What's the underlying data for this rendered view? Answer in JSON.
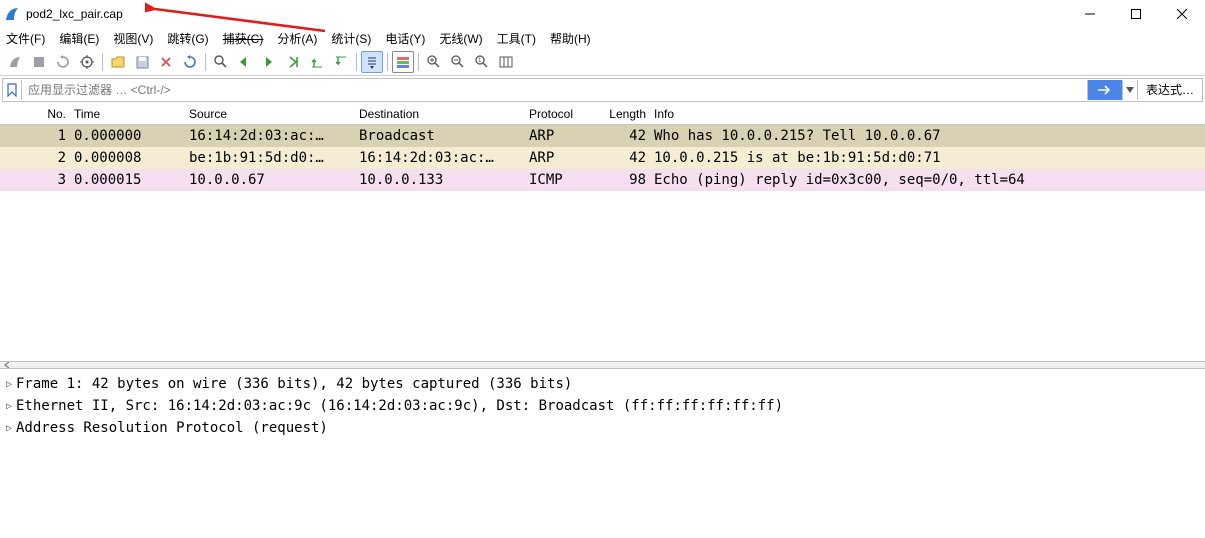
{
  "title": "pod2_lxc_pair.cap",
  "menu": {
    "file": "文件(F)",
    "edit": "编辑(E)",
    "view": "视图(V)",
    "go": "跳转(G)",
    "capture": "捕获(C)",
    "analyze": "分析(A)",
    "stat": "统计(S)",
    "tel": "电话(Y)",
    "wireless": "无线(W)",
    "tools": "工具(T)",
    "help": "帮助(H)"
  },
  "filter_placeholder": "应用显示过滤器 … <Ctrl-/>",
  "expr_label": "表达式…",
  "headers": {
    "no": "No.",
    "time": "Time",
    "src": "Source",
    "dst": "Destination",
    "proto": "Protocol",
    "len": "Length",
    "info": "Info"
  },
  "rows": [
    {
      "no": "1",
      "time": "0.000000",
      "src": "16:14:2d:03:ac:…",
      "dst": "Broadcast",
      "proto": "ARP",
      "len": "42",
      "info": "Who has 10.0.0.215? Tell 10.0.0.67",
      "cls": "r1"
    },
    {
      "no": "2",
      "time": "0.000008",
      "src": "be:1b:91:5d:d0:…",
      "dst": "16:14:2d:03:ac:…",
      "proto": "ARP",
      "len": "42",
      "info": "10.0.0.215 is at be:1b:91:5d:d0:71",
      "cls": "r2"
    },
    {
      "no": "3",
      "time": "0.000015",
      "src": "10.0.0.67",
      "dst": "10.0.0.133",
      "proto": "ICMP",
      "len": "98",
      "info": "Echo (ping) reply    id=0x3c00, seq=0/0, ttl=64",
      "cls": "r3"
    }
  ],
  "details": [
    "Frame 1: 42 bytes on wire (336 bits), 42 bytes captured (336 bits)",
    "Ethernet II, Src: 16:14:2d:03:ac:9c (16:14:2d:03:ac:9c), Dst: Broadcast (ff:ff:ff:ff:ff:ff)",
    "Address Resolution Protocol (request)"
  ],
  "icons": {
    "fin": "shark-fin-icon",
    "min": "minimize-icon",
    "max": "maximize-icon",
    "close": "close-icon",
    "bookmark": "bookmark-icon",
    "go": "go-arrow-icon",
    "drop": "dropdown-icon"
  }
}
